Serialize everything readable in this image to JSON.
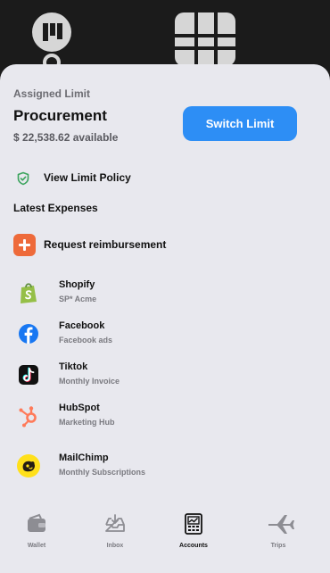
{
  "top": {
    "icons": [
      "trello-logo-icon",
      "grid-card-icon",
      "ring-icon"
    ]
  },
  "limit": {
    "section_label": "Assigned Limit",
    "name": "Procurement",
    "available": "$ 22,538.62 available",
    "switch_label": "Switch Limit"
  },
  "policy": {
    "label": "View Limit Policy",
    "icon": "shield-check-icon"
  },
  "expenses": {
    "section_label": "Latest Expenses",
    "reimburse_label": "Request reimbursement",
    "items": [
      {
        "name": "Shopify",
        "sub": "SP* Acme",
        "icon": "shopify-icon"
      },
      {
        "name": "Facebook",
        "sub": "Facebook ads",
        "icon": "facebook-icon"
      },
      {
        "name": "Tiktok",
        "sub": "Monthly Invoice",
        "icon": "tiktok-icon"
      },
      {
        "name": "HubSpot",
        "sub": "Marketing Hub",
        "icon": "hubspot-icon"
      },
      {
        "name": "MailChimp",
        "sub": "Monthly Subscriptions",
        "icon": "mailchimp-icon"
      }
    ]
  },
  "nav": {
    "active": "Accounts",
    "items": [
      {
        "label": "Wallet",
        "icon": "wallet-icon"
      },
      {
        "label": "Inbox",
        "icon": "inbox-icon"
      },
      {
        "label": "Accounts",
        "icon": "accounts-icon"
      },
      {
        "label": "Trips",
        "icon": "airplane-icon"
      }
    ]
  },
  "colors": {
    "accent": "#2d8ef5",
    "reimburse": "#ee6a3a",
    "sheet_bg": "#e8e8ee",
    "top_bg": "#1b1b1b"
  }
}
